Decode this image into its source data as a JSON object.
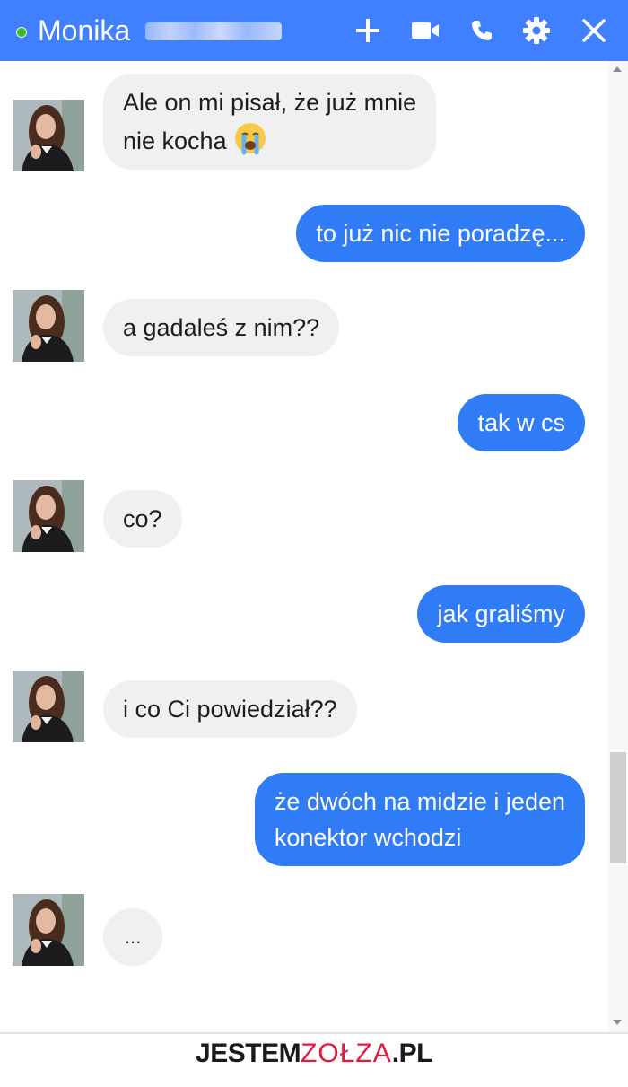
{
  "header": {
    "contact_name": "Monika",
    "online_color": "#42b72a",
    "background_color": "#4080ff",
    "buttons": [
      {
        "name": "add-people-icon",
        "label": "+"
      },
      {
        "name": "video-call-icon",
        "label": "video"
      },
      {
        "name": "voice-call-icon",
        "label": "phone"
      },
      {
        "name": "gear-icon",
        "label": "settings"
      },
      {
        "name": "close-icon",
        "label": "close"
      }
    ]
  },
  "messages": [
    {
      "sender": "them",
      "lines": [
        "Ale on mi pisał, że już mnie",
        "nie kocha"
      ],
      "emoji": "crying-face"
    },
    {
      "sender": "me",
      "lines": [
        "to już nic nie poradzę..."
      ]
    },
    {
      "sender": "them",
      "lines": [
        "a gadaleś z nim??"
      ]
    },
    {
      "sender": "me",
      "lines": [
        "tak w cs"
      ]
    },
    {
      "sender": "them",
      "lines": [
        "co?"
      ]
    },
    {
      "sender": "me",
      "lines": [
        "jak graliśmy"
      ]
    },
    {
      "sender": "them",
      "lines": [
        "i co Ci powiedział??"
      ]
    },
    {
      "sender": "me",
      "lines": [
        "że dwóch na midzie i jeden",
        "konektor wchodzi"
      ]
    },
    {
      "sender": "them",
      "lines": [
        "..."
      ]
    }
  ],
  "colors": {
    "outgoing_bubble": "#2f7cf6",
    "incoming_bubble": "#f1f0f0"
  },
  "watermark": {
    "prefix": "JESTEM",
    "brand": "ZOŁZA",
    "suffix": ".PL"
  }
}
